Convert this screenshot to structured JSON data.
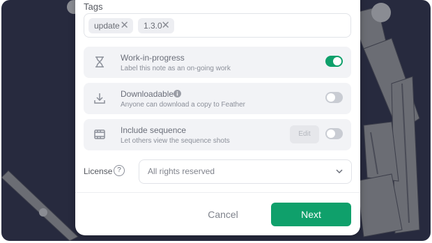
{
  "tags": {
    "label": "Tags",
    "chips": [
      {
        "text": "update",
        "remove": "✕"
      },
      {
        "text": "1.3.0",
        "remove": "✕"
      }
    ]
  },
  "options": [
    {
      "title": "Work-in-progress",
      "subtitle": "Label this note as an on-going work",
      "icon": "hourglass-icon",
      "enabled": true
    },
    {
      "title": "Downloadable",
      "subtitle": "Anyone can download a copy to Feather",
      "icon": "download-icon",
      "info_icon": "info-icon",
      "enabled": false
    },
    {
      "title": "Include sequence",
      "subtitle": "Let others view the sequence shots",
      "icon": "film-icon",
      "edit_label": "Edit",
      "enabled": false
    }
  ],
  "license": {
    "label": "License",
    "help": "?",
    "value": "All rights reserved"
  },
  "footer": {
    "cancel_label": "Cancel",
    "next_label": "Next"
  },
  "colors": {
    "accent": "#0fa06b",
    "backdrop": "#272a3e"
  }
}
